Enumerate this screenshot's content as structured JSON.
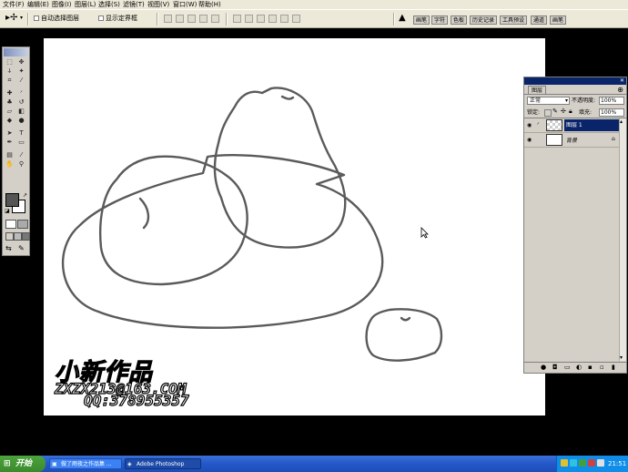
{
  "menu": {
    "items": [
      "文件(F)",
      "编辑(E)",
      "图像(I)",
      "图层(L)",
      "选择(S)",
      "滤镜(T)",
      "视图(V)",
      "窗口(W)",
      "帮助(H)"
    ]
  },
  "options_bar": {
    "auto_select_layer": "自动选择图层",
    "show_bounding_box": "显示定界框"
  },
  "palette_well": {
    "tabs": [
      "画笔",
      "字符",
      "色板",
      "历史记录",
      "工具预设",
      "通道",
      "画笔"
    ]
  },
  "layers_panel": {
    "tab_label": "图层",
    "blend_mode": "正常",
    "opacity_label": "不透明度:",
    "opacity_value": "100%",
    "lock_label": "锁定:",
    "fill_label": "填充:",
    "fill_value": "100%",
    "layers": [
      {
        "name": "图层 1",
        "selected": true
      },
      {
        "name": "背景",
        "selected": false
      }
    ]
  },
  "watermark": {
    "title": "小新作品",
    "email": "ZXZX213@163.COM",
    "qq": "QQ:378955357"
  },
  "taskbar": {
    "start_label": "开始",
    "task1": "做了雨夜之作品集 ...",
    "task2": "Adobe Photoshop",
    "clock": "21:51"
  },
  "colors": {
    "accent": "#0a246a",
    "ui_face": "#d4d0c8",
    "taskbar": "#2458c8"
  }
}
